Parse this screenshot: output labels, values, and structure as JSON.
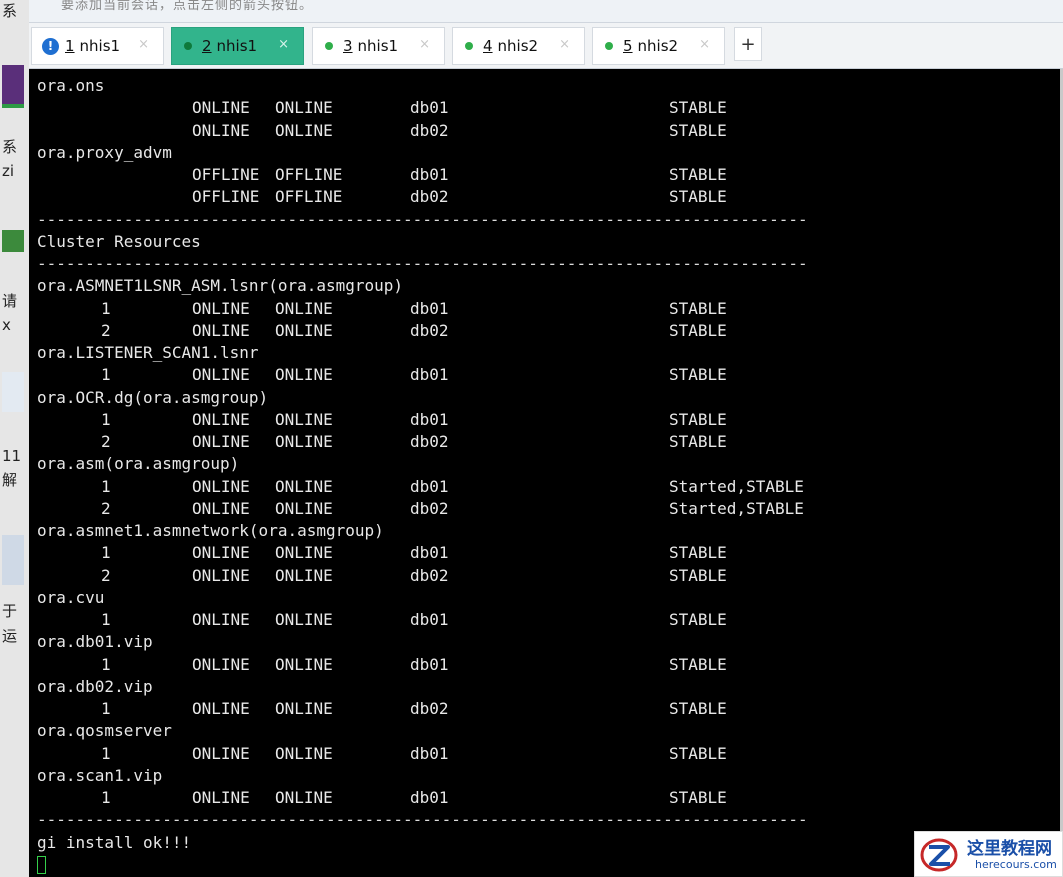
{
  "background_hint": "要添加当前会话，点击左侧的箭头按钮。",
  "left_strip_glyphs": [
    "系",
    "系",
    "zi",
    "请",
    "x",
    "11",
    "解",
    "于",
    "运"
  ],
  "tabs": [
    {
      "num": "1",
      "label": "nhis1",
      "indicator": "warning",
      "active": false
    },
    {
      "num": "2",
      "label": "nhis1",
      "indicator": "connected",
      "active": true
    },
    {
      "num": "3",
      "label": "nhis1",
      "indicator": "connected",
      "active": false
    },
    {
      "num": "4",
      "label": "nhis2",
      "indicator": "connected",
      "active": false
    },
    {
      "num": "5",
      "label": "nhis2",
      "indicator": "connected",
      "active": false
    }
  ],
  "tab_close_glyph": "×",
  "warning_glyph": "!",
  "add_tab_glyph": "+",
  "terminal": {
    "lines": [
      {
        "kind": "resource",
        "text": "ora.ons"
      },
      {
        "kind": "row",
        "inst": "",
        "target": "ONLINE",
        "state": "ONLINE",
        "server": "db01",
        "details": "STABLE"
      },
      {
        "kind": "row",
        "inst": "",
        "target": "ONLINE",
        "state": "ONLINE",
        "server": "db02",
        "details": "STABLE"
      },
      {
        "kind": "resource",
        "text": "ora.proxy_advm"
      },
      {
        "kind": "row",
        "inst": "",
        "target": "OFFLINE",
        "state": "OFFLINE",
        "server": "db01",
        "details": "STABLE"
      },
      {
        "kind": "row",
        "inst": "",
        "target": "OFFLINE",
        "state": "OFFLINE",
        "server": "db02",
        "details": "STABLE"
      },
      {
        "kind": "sep",
        "text": "--------------------------------------------------------------------------------"
      },
      {
        "kind": "resource",
        "text": "Cluster Resources"
      },
      {
        "kind": "sep",
        "text": "--------------------------------------------------------------------------------"
      },
      {
        "kind": "resource",
        "text": "ora.ASMNET1LSNR_ASM.lsnr(ora.asmgroup)"
      },
      {
        "kind": "row",
        "inst": "1",
        "target": "ONLINE",
        "state": "ONLINE",
        "server": "db01",
        "details": "STABLE"
      },
      {
        "kind": "row",
        "inst": "2",
        "target": "ONLINE",
        "state": "ONLINE",
        "server": "db02",
        "details": "STABLE"
      },
      {
        "kind": "resource",
        "text": "ora.LISTENER_SCAN1.lsnr"
      },
      {
        "kind": "row",
        "inst": "1",
        "target": "ONLINE",
        "state": "ONLINE",
        "server": "db01",
        "details": "STABLE"
      },
      {
        "kind": "resource",
        "text": "ora.OCR.dg(ora.asmgroup)"
      },
      {
        "kind": "row",
        "inst": "1",
        "target": "ONLINE",
        "state": "ONLINE",
        "server": "db01",
        "details": "STABLE"
      },
      {
        "kind": "row",
        "inst": "2",
        "target": "ONLINE",
        "state": "ONLINE",
        "server": "db02",
        "details": "STABLE"
      },
      {
        "kind": "resource",
        "text": "ora.asm(ora.asmgroup)"
      },
      {
        "kind": "row",
        "inst": "1",
        "target": "ONLINE",
        "state": "ONLINE",
        "server": "db01",
        "details": "Started,STABLE"
      },
      {
        "kind": "row",
        "inst": "2",
        "target": "ONLINE",
        "state": "ONLINE",
        "server": "db02",
        "details": "Started,STABLE"
      },
      {
        "kind": "resource",
        "text": "ora.asmnet1.asmnetwork(ora.asmgroup)"
      },
      {
        "kind": "row",
        "inst": "1",
        "target": "ONLINE",
        "state": "ONLINE",
        "server": "db01",
        "details": "STABLE"
      },
      {
        "kind": "row",
        "inst": "2",
        "target": "ONLINE",
        "state": "ONLINE",
        "server": "db02",
        "details": "STABLE"
      },
      {
        "kind": "resource",
        "text": "ora.cvu"
      },
      {
        "kind": "row",
        "inst": "1",
        "target": "ONLINE",
        "state": "ONLINE",
        "server": "db01",
        "details": "STABLE"
      },
      {
        "kind": "resource",
        "text": "ora.db01.vip"
      },
      {
        "kind": "row",
        "inst": "1",
        "target": "ONLINE",
        "state": "ONLINE",
        "server": "db01",
        "details": "STABLE"
      },
      {
        "kind": "resource",
        "text": "ora.db02.vip"
      },
      {
        "kind": "row",
        "inst": "1",
        "target": "ONLINE",
        "state": "ONLINE",
        "server": "db02",
        "details": "STABLE"
      },
      {
        "kind": "resource",
        "text": "ora.qosmserver"
      },
      {
        "kind": "row",
        "inst": "1",
        "target": "ONLINE",
        "state": "ONLINE",
        "server": "db01",
        "details": "STABLE"
      },
      {
        "kind": "resource",
        "text": "ora.scan1.vip"
      },
      {
        "kind": "row",
        "inst": "1",
        "target": "ONLINE",
        "state": "ONLINE",
        "server": "db01",
        "details": "STABLE"
      },
      {
        "kind": "sep",
        "text": "--------------------------------------------------------------------------------"
      },
      {
        "kind": "resource",
        "text": "gi install ok!!!"
      }
    ]
  },
  "watermark": {
    "title": "这里教程网",
    "subtitle": "herecours.com"
  },
  "colors": {
    "active_tab": "#32b48c",
    "status_dot": "#2fae4a",
    "warning_icon": "#1f6fd1",
    "cursor": "#35d04a",
    "terminal_bg": "#000000",
    "terminal_fg": "#e8e8e8"
  }
}
